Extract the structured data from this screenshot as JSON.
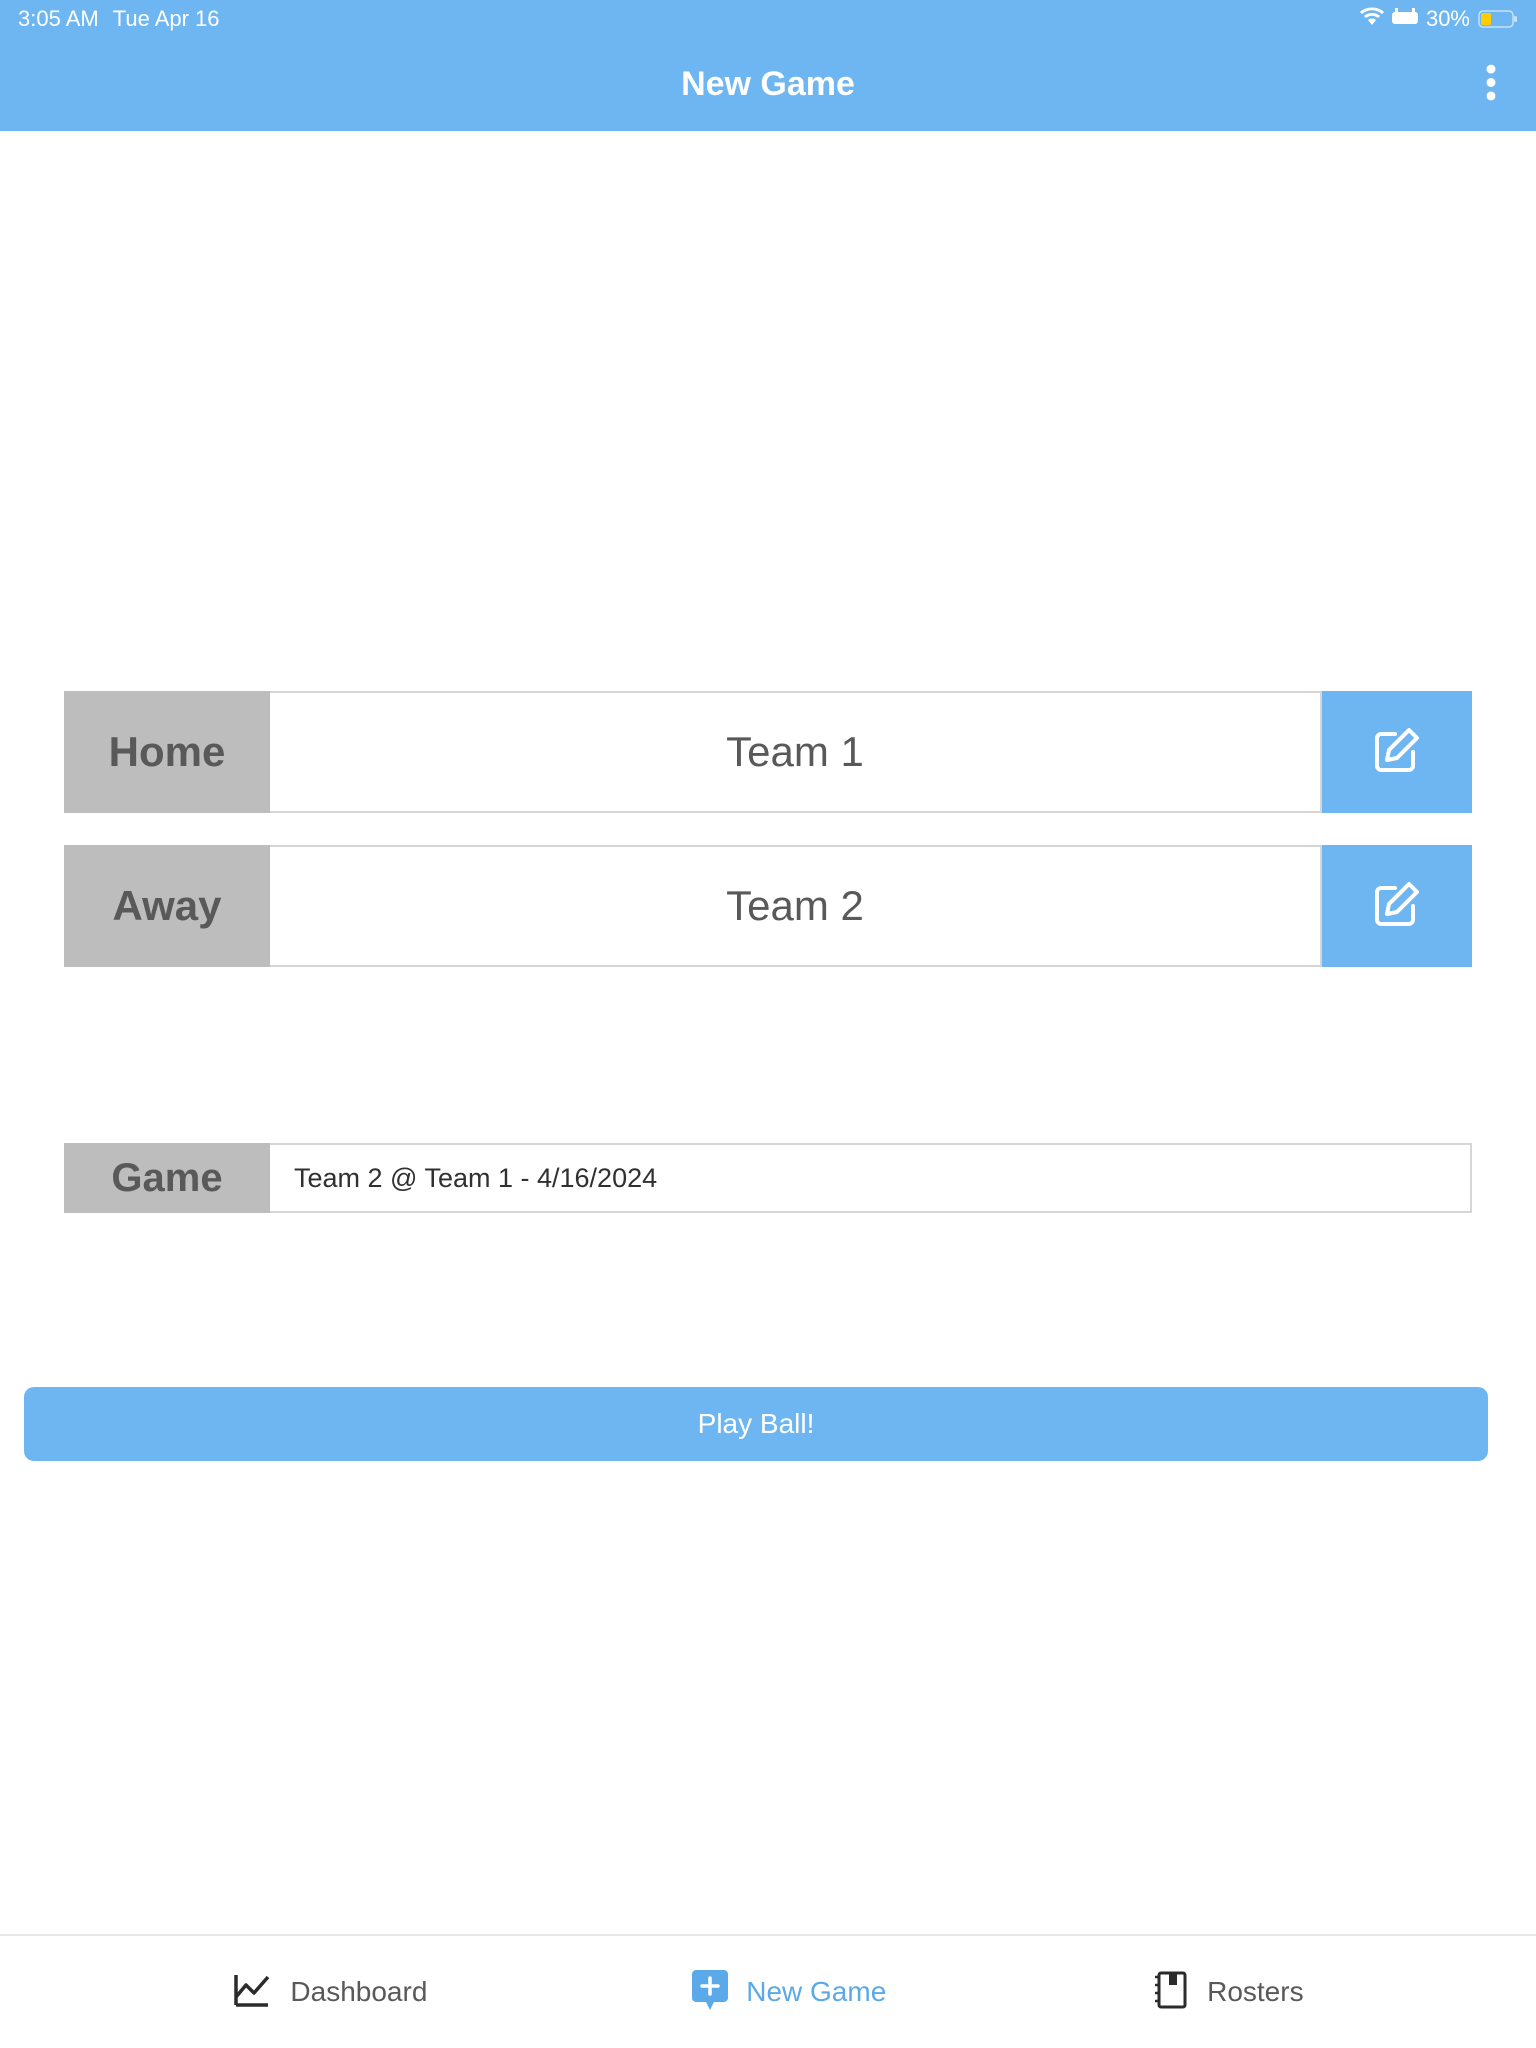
{
  "status_bar": {
    "time": "3:05 AM",
    "date": "Tue Apr 16",
    "battery_percent": "30%"
  },
  "nav": {
    "title": "New Game"
  },
  "teams": {
    "home": {
      "label": "Home",
      "value": "Team 1"
    },
    "away": {
      "label": "Away",
      "value": "Team 2"
    }
  },
  "game": {
    "label": "Game",
    "value": "Team 2 @ Team 1 - 4/16/2024"
  },
  "play_button": {
    "label": "Play Ball!"
  },
  "tabs": {
    "dashboard": "Dashboard",
    "new_game": "New Game",
    "rosters": "Rosters"
  }
}
